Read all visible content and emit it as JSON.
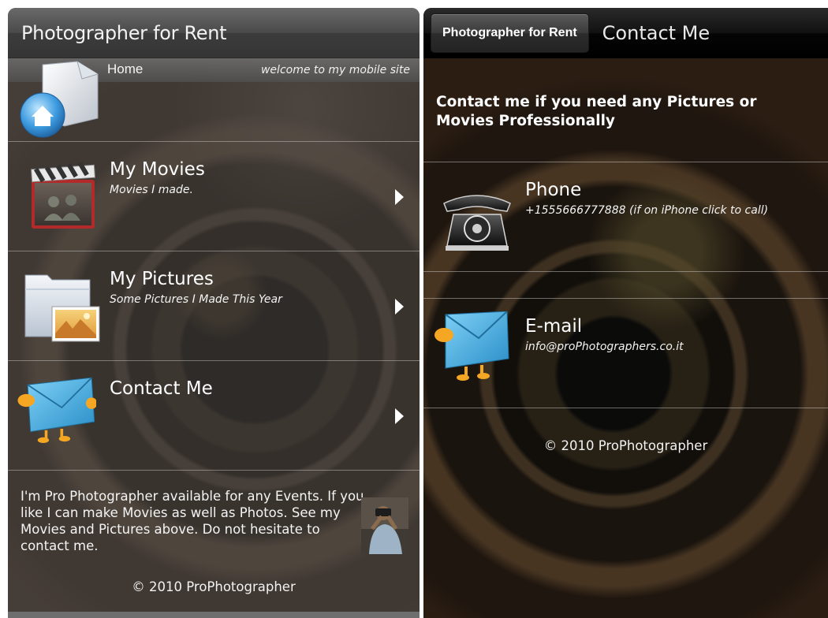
{
  "left_screen": {
    "header": {
      "title": "Photographer for Rent"
    },
    "home": {
      "label": "Home",
      "tagline": "welcome to my mobile site",
      "icon": "home-folder-icon"
    },
    "menu": [
      {
        "title": "My Movies",
        "subtitle": "Movies I made.",
        "icon": "movie-clapper-icon"
      },
      {
        "title": "My Pictures",
        "subtitle": "Some Pictures I Made This Year",
        "icon": "pictures-folder-icon"
      },
      {
        "title": "Contact Me",
        "subtitle": "",
        "icon": "envelope-mascot-icon"
      }
    ],
    "about": {
      "text": "I'm Pro Photographer available for any Events. If you like I can make Movies as well as Photos. See my Movies and Pictures above. Do not hesitate to contact me.",
      "photo": "photographer-avatar"
    },
    "footer": "© 2010 ProPhotographer"
  },
  "right_screen": {
    "tabs": {
      "back": "Photographer for Rent",
      "current": "Contact Me"
    },
    "intro": "Contact me if you need any Pictures or Movies Professionally",
    "contacts": [
      {
        "title": "Phone",
        "detail": "+1555666777888 (if on iPhone click to call)",
        "icon": "telephone-icon"
      },
      {
        "title": "E-mail",
        "detail": "info@proPhotographers.co.it",
        "icon": "envelope-mascot-icon"
      }
    ],
    "footer": "© 2010 ProPhotographer"
  },
  "colors": {
    "header_gray": "#4a4a4a",
    "header_black": "#050505",
    "text_white": "#ffffff"
  }
}
